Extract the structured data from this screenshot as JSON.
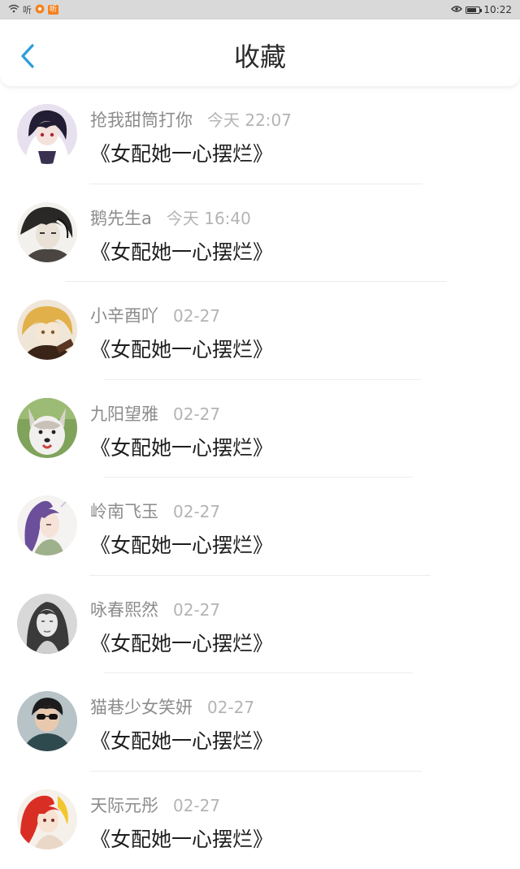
{
  "status_bar": {
    "left_text": "听",
    "badge_text": "听",
    "time": "10:22"
  },
  "header": {
    "title": "收藏"
  },
  "favorites": [
    {
      "user": "抢我甜筒打你",
      "time": "今天 22:07",
      "title": "《女配她一心摆烂》",
      "avatar": "avatar-dark-hair-anime"
    },
    {
      "user": "鹅先生a",
      "time": "今天 16:40",
      "title": "《女配她一心摆烂》",
      "avatar": "avatar-sketch-character"
    },
    {
      "user": "小辛酉吖",
      "time": "02-27",
      "title": "《女配她一心摆烂》",
      "avatar": "avatar-blonde-anime"
    },
    {
      "user": "九阳望雅",
      "time": "02-27",
      "title": "《女配她一心摆烂》",
      "avatar": "avatar-husky-dog"
    },
    {
      "user": "岭南飞玉",
      "time": "02-27",
      "title": "《女配她一心摆烂》",
      "avatar": "avatar-purple-hair-illustration"
    },
    {
      "user": "咏春熙然",
      "time": "02-27",
      "title": "《女配她一心摆烂》",
      "avatar": "avatar-bw-portrait"
    },
    {
      "user": "猫巷少女笑妍",
      "time": "02-27",
      "title": "《女配她一心摆烂》",
      "avatar": "avatar-sunglasses-man"
    },
    {
      "user": "天际元彤",
      "time": "02-27",
      "title": "《女配她一心摆烂》",
      "avatar": "avatar-red-hair-anime"
    }
  ]
}
